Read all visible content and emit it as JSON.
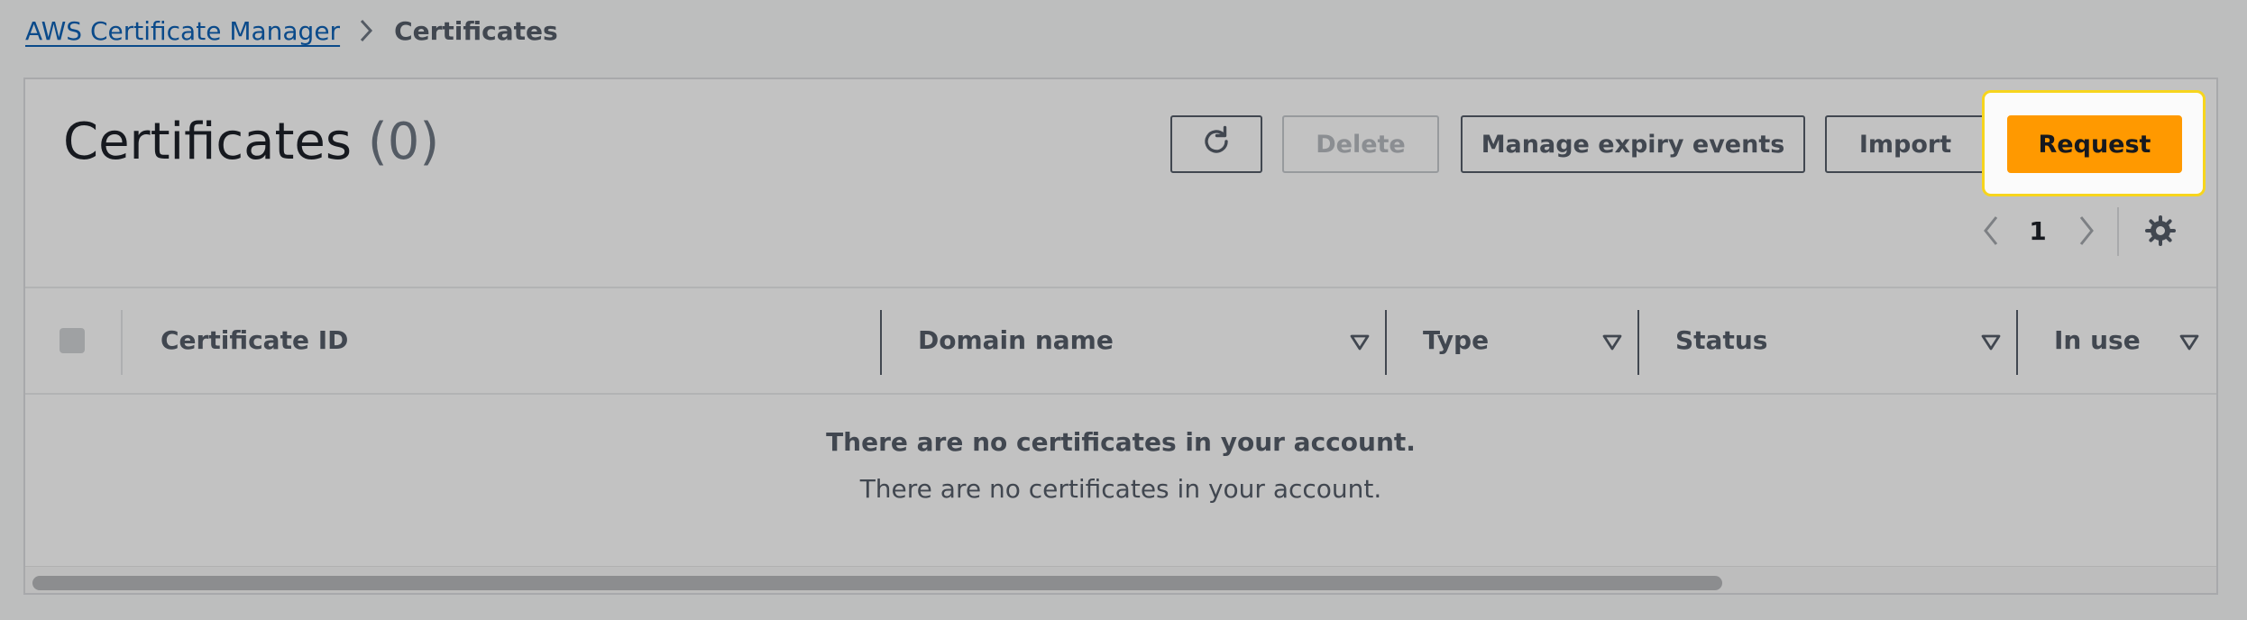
{
  "breadcrumb": {
    "parent": "AWS Certificate Manager",
    "current": "Certificates"
  },
  "header": {
    "title": "Certificates",
    "count": "(0)"
  },
  "actions": {
    "refresh_icon": "refresh-icon",
    "delete": "Delete",
    "manage_expiry": "Manage expiry events",
    "import": "Import",
    "request": "Request",
    "request_color": "#ff9900",
    "highlight_color": "#f7d51d"
  },
  "pagination": {
    "current_page": "1",
    "prev_icon": "chevron-left-icon",
    "next_icon": "chevron-right-icon",
    "settings_icon": "gear-icon"
  },
  "table": {
    "columns": [
      {
        "label": "Certificate ID",
        "sortable": false
      },
      {
        "label": "Domain name",
        "sortable": true
      },
      {
        "label": "Type",
        "sortable": true
      },
      {
        "label": "Status",
        "sortable": true
      },
      {
        "label": "In use",
        "sortable": true
      }
    ],
    "rows": [],
    "empty": {
      "title": "There are no certificates in your account.",
      "description": "There are no certificates in your account."
    }
  }
}
